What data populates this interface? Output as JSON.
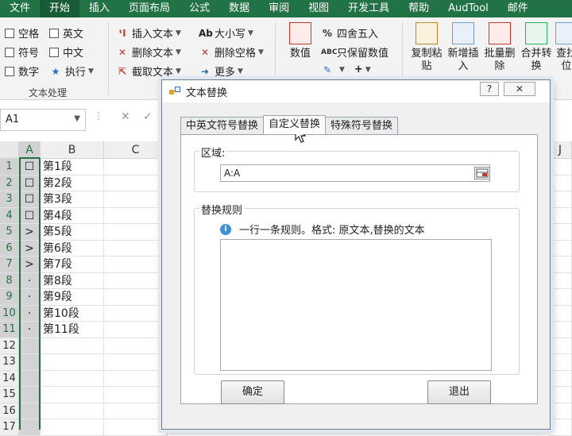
{
  "menu_tabs": [
    "文件",
    "开始",
    "插入",
    "页面布局",
    "公式",
    "数据",
    "审阅",
    "视图",
    "开发工具",
    "帮助",
    "AudTool",
    "邮件"
  ],
  "ribbon": {
    "checks": [
      {
        "label": "空格"
      },
      {
        "label": "英文"
      },
      {
        "label": "符号"
      },
      {
        "label": "中文"
      },
      {
        "label": "数字"
      }
    ],
    "execute_label": "执行",
    "group1_label": "文本处理",
    "insert_text": "插入文本",
    "delete_text": "删除文本",
    "extract_text": "截取文本",
    "case_label": "大小写",
    "delete_space": "删除空格",
    "more_label": "更多",
    "value_label": "数值",
    "round_label": "四舍五入",
    "keep_value": "只保留数值",
    "copy_paste": [
      "复制粘",
      "贴"
    ],
    "add_insert": [
      "新增插",
      "入"
    ],
    "batch_delete": [
      "批量删",
      "除"
    ],
    "merge_convert": [
      "合并转",
      "换"
    ],
    "find_pos": [
      "查找",
      "位"
    ]
  },
  "namebox": "A1",
  "columns": [
    "A",
    "B",
    "C",
    "J"
  ],
  "rows": [
    {
      "n": "1",
      "a": "☐",
      "b": "第1段"
    },
    {
      "n": "2",
      "a": "☐",
      "b": "第2段"
    },
    {
      "n": "3",
      "a": "☐",
      "b": "第3段"
    },
    {
      "n": "4",
      "a": "☐",
      "b": "第4段"
    },
    {
      "n": "5",
      "a": ">",
      "b": "第5段"
    },
    {
      "n": "6",
      "a": ">",
      "b": "第6段"
    },
    {
      "n": "7",
      "a": ">",
      "b": "第7段"
    },
    {
      "n": "8",
      "a": "·",
      "b": "第8段"
    },
    {
      "n": "9",
      "a": "·",
      "b": "第9段"
    },
    {
      "n": "10",
      "a": "·",
      "b": "第10段"
    },
    {
      "n": "11",
      "a": "·",
      "b": "第11段"
    },
    {
      "n": "12",
      "a": "",
      "b": ""
    },
    {
      "n": "13",
      "a": "",
      "b": ""
    },
    {
      "n": "14",
      "a": "",
      "b": ""
    },
    {
      "n": "15",
      "a": "",
      "b": ""
    },
    {
      "n": "16",
      "a": "",
      "b": ""
    },
    {
      "n": "17",
      "a": "",
      "b": ""
    }
  ],
  "dialog": {
    "title": "文本替换",
    "help_btn": "?",
    "close_btn": "✕",
    "tabs": [
      "中英文符号替换",
      "自定义替换",
      "特殊符号替换"
    ],
    "active_tab": 1,
    "range_legend": "区域:",
    "range_value": "A:A",
    "rules_legend": "替换规则",
    "info_icon": "i",
    "info_text": "一行一条规则。格式: 原文本,替换的文本",
    "rules_value": "",
    "ok_label": "确定",
    "exit_label": "退出"
  }
}
